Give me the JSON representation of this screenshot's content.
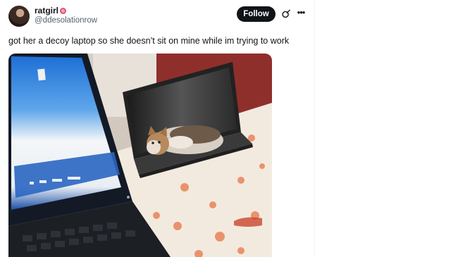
{
  "tweet": {
    "author": {
      "display_name": "ratgirl",
      "handle": "@ddesolationrow",
      "badge": "pink-flower-badge-icon"
    },
    "follow_label": "Follow",
    "text": "got her a decoy laptop so she doesn’t sit on mine while im trying to work",
    "icons": {
      "grok": "grok-icon",
      "more": "more-icon"
    }
  },
  "colors": {
    "text_primary": "#0f1419",
    "text_secondary": "#536471",
    "follow_bg": "#0f1419",
    "follow_text": "#ffffff"
  },
  "media": {
    "icon": "photo"
  }
}
